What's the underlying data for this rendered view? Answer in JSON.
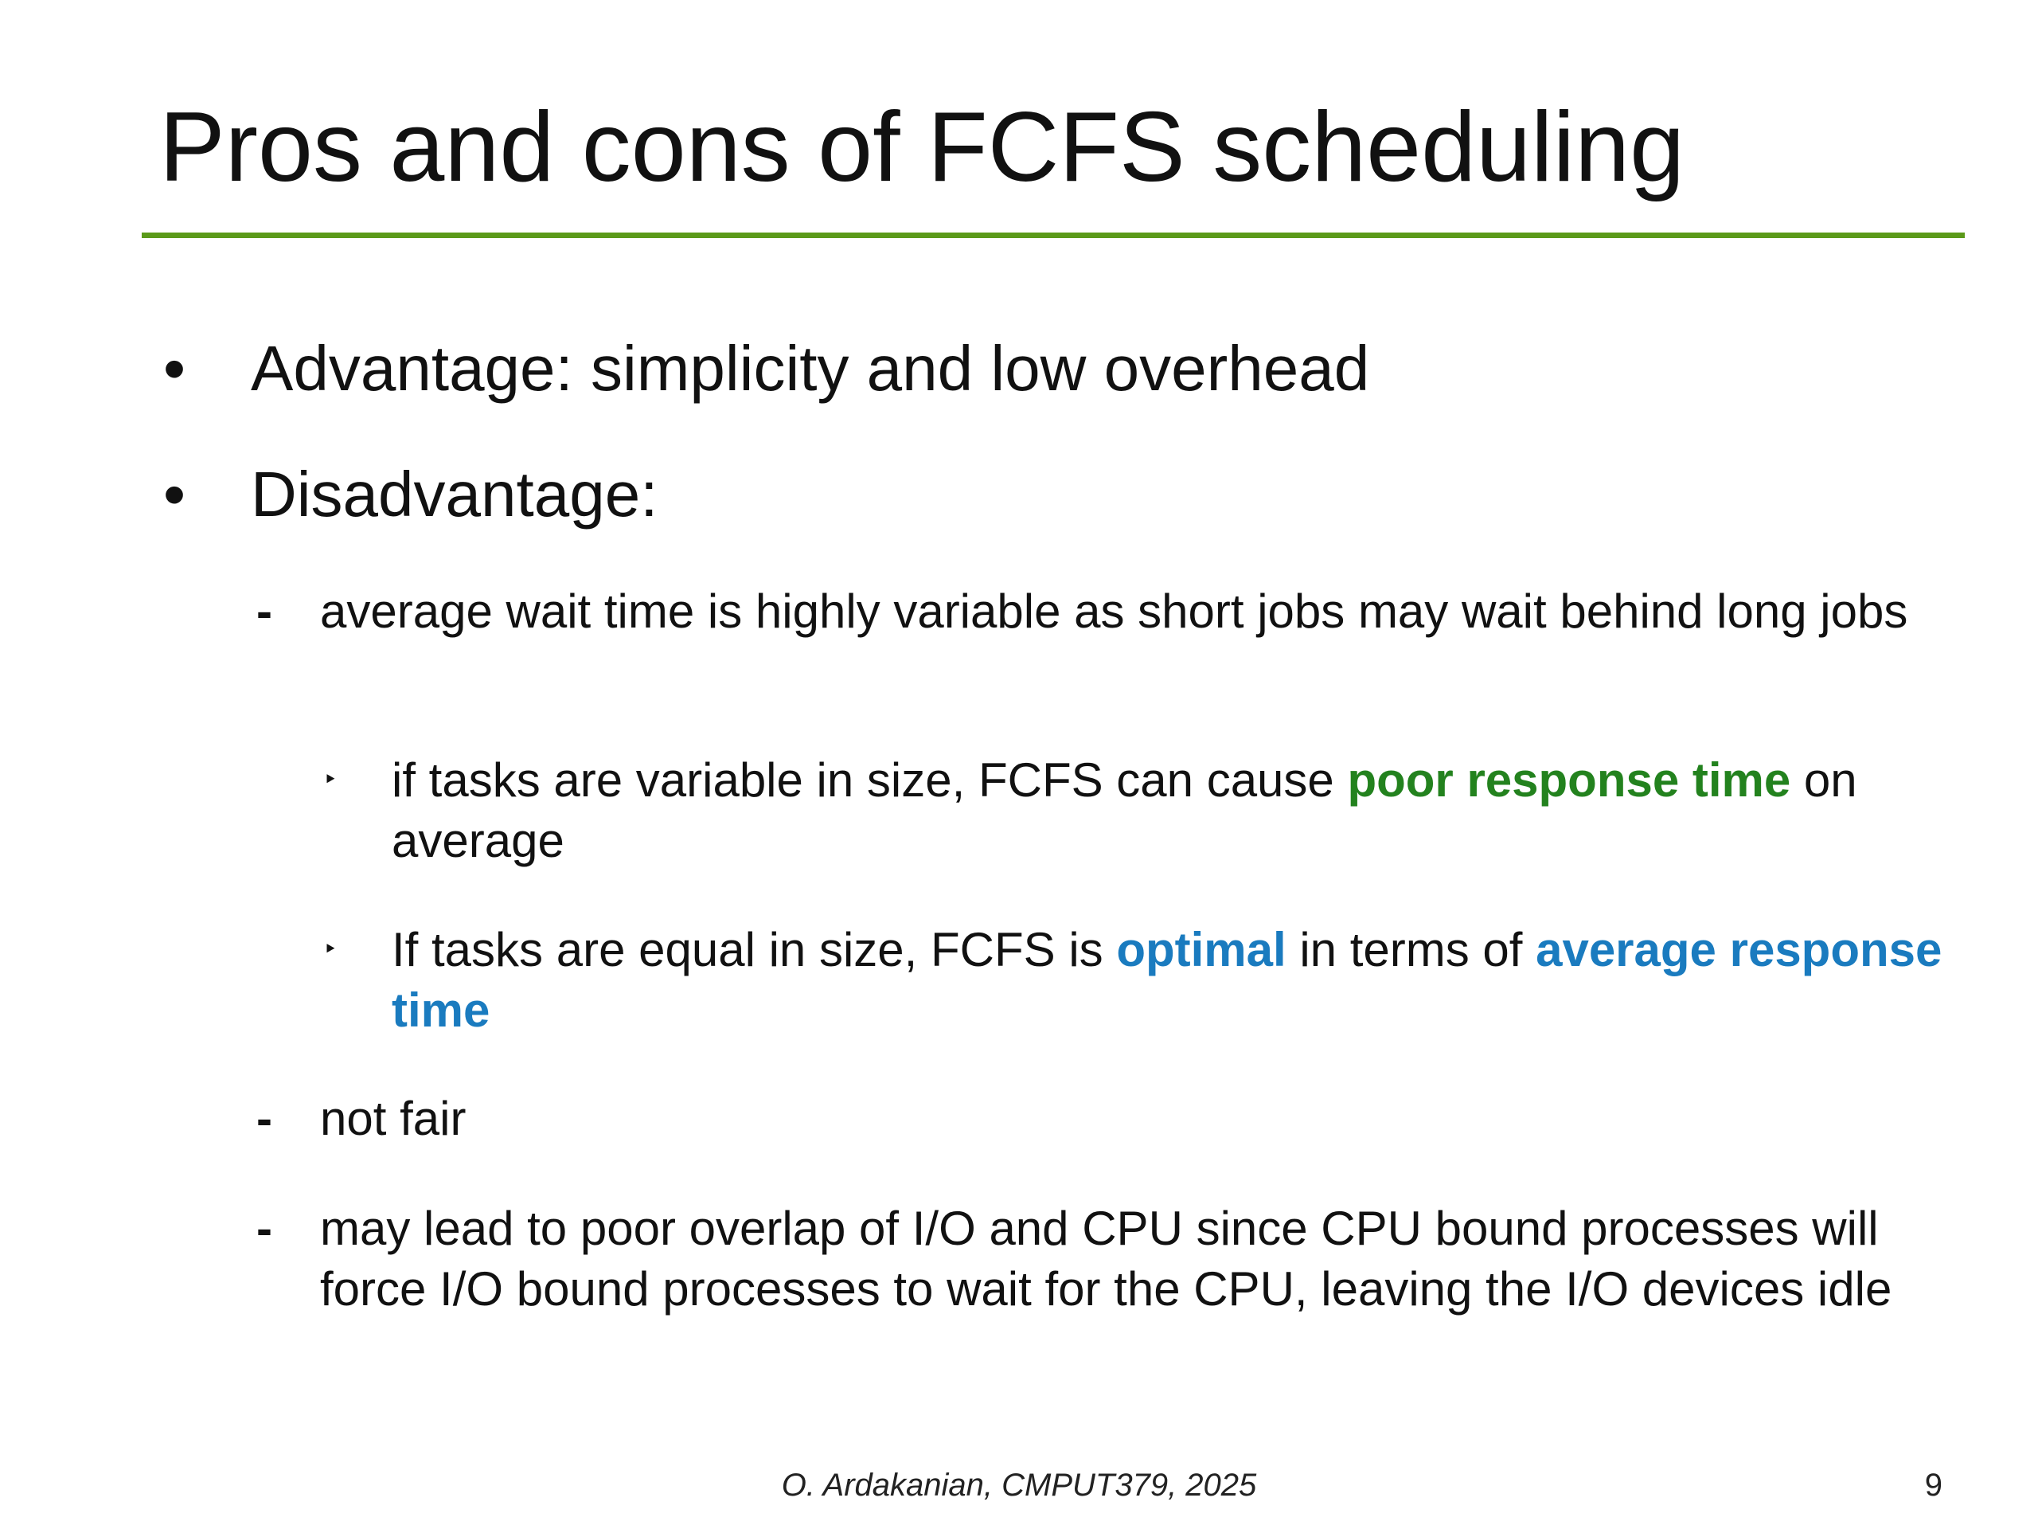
{
  "slide": {
    "title": "Pros and cons of FCFS scheduling",
    "bullets": [
      {
        "mark": "•",
        "text": "Advantage: simplicity and low overhead"
      },
      {
        "mark": "•",
        "text": "Disadvantage:"
      }
    ],
    "subpoints": [
      {
        "mark": "-",
        "text": "average wait time is highly variable as short jobs may wait behind long jobs"
      },
      {
        "mark": "-",
        "text": "not fair"
      },
      {
        "mark": "-",
        "text": "may lead to poor overlap of I/O and CPU since CPU bound processes will force I/O bound processes to wait for the CPU, leaving the I/O devices idle"
      }
    ],
    "subsubpoints": [
      {
        "mark": "‣",
        "before": "if tasks are variable in size, FCFS can cause ",
        "emph": "poor response time",
        "after": " on average"
      },
      {
        "mark": "‣",
        "before": "If tasks are equal in size, FCFS is ",
        "emph1": "optimal",
        "middle": " in terms of ",
        "emph2": "average response time"
      }
    ],
    "footer": {
      "credit": "O. Ardakanian, CMPUT379, 2025",
      "page_number": "9"
    },
    "colors": {
      "title_rule": "#5b9a1a",
      "green_emphasis": "#23821e",
      "blue_emphasis": "#1a7bbf"
    }
  }
}
